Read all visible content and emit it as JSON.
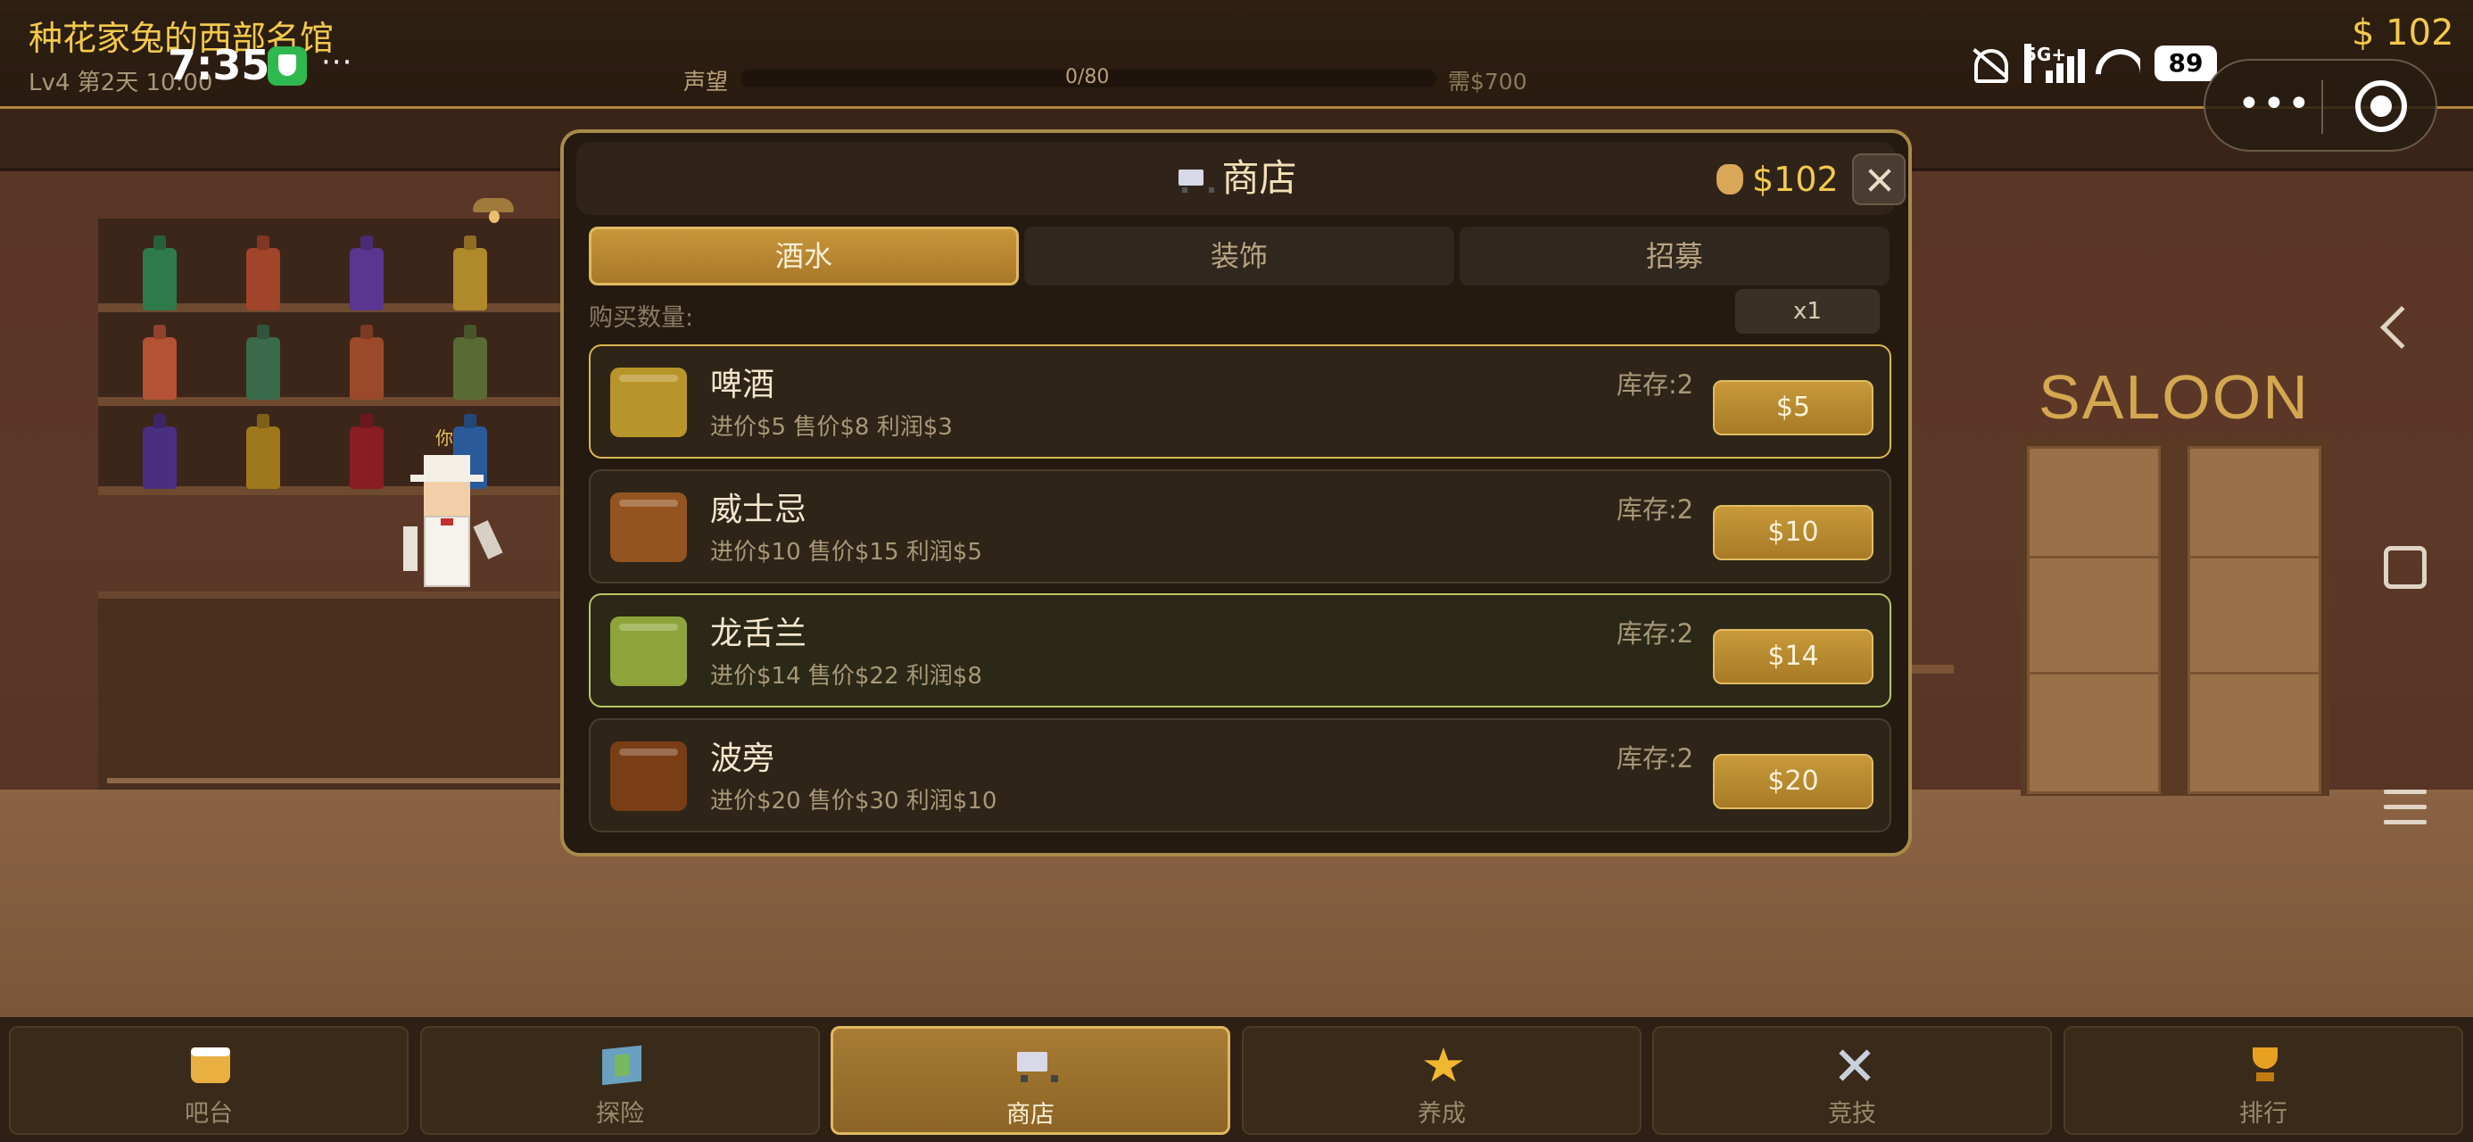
{
  "game": {
    "title": "种花家兔的西部名馆",
    "level_info": "Lv4 第2天 10:00",
    "money": "$ 102"
  },
  "reputation": {
    "label": "声望",
    "progress_text": "0/80",
    "progress_fraction": 0,
    "need": "需$700"
  },
  "system_status": {
    "time": "7:35",
    "more": "···",
    "network": "5G+",
    "battery": "89"
  },
  "scene": {
    "player_label": "你",
    "sign": "SALOON"
  },
  "shop": {
    "title": "商店",
    "money": "$102",
    "tabs": [
      {
        "label": "酒水",
        "active": true
      },
      {
        "label": "装饰",
        "active": false
      },
      {
        "label": "招募",
        "active": false
      }
    ],
    "quantity_label": "购买数量:",
    "quantity_value": "x1",
    "items": [
      {
        "name": "啤酒",
        "desc": "进价$5 售价$8 利润$3",
        "stock": "库存:2",
        "price": "$5",
        "color": "#b8952a"
      },
      {
        "name": "威士忌",
        "desc": "进价$10 售价$15 利润$5",
        "stock": "库存:2",
        "price": "$10",
        "color": "#94541f"
      },
      {
        "name": "龙舌兰",
        "desc": "进价$14 售价$22 利润$8",
        "stock": "库存:2",
        "price": "$14",
        "color": "#8ea43a"
      },
      {
        "name": "波旁",
        "desc": "进价$20 售价$30 利润$10",
        "stock": "库存:2",
        "price": "$20",
        "color": "#7a3e16"
      }
    ]
  },
  "bottom_nav": [
    {
      "label": "吧台",
      "icon": "beer-mug-icon",
      "active": false
    },
    {
      "label": "探险",
      "icon": "map-icon",
      "active": false
    },
    {
      "label": "商店",
      "icon": "cart-icon",
      "active": true
    },
    {
      "label": "养成",
      "icon": "star-icon",
      "active": false
    },
    {
      "label": "竞技",
      "icon": "crossed-swords-icon",
      "active": false
    },
    {
      "label": "排行",
      "icon": "trophy-icon",
      "active": false
    }
  ],
  "colors": {
    "accent": "#f2c94c",
    "panel": "#241a10",
    "button": "#b8892e"
  }
}
